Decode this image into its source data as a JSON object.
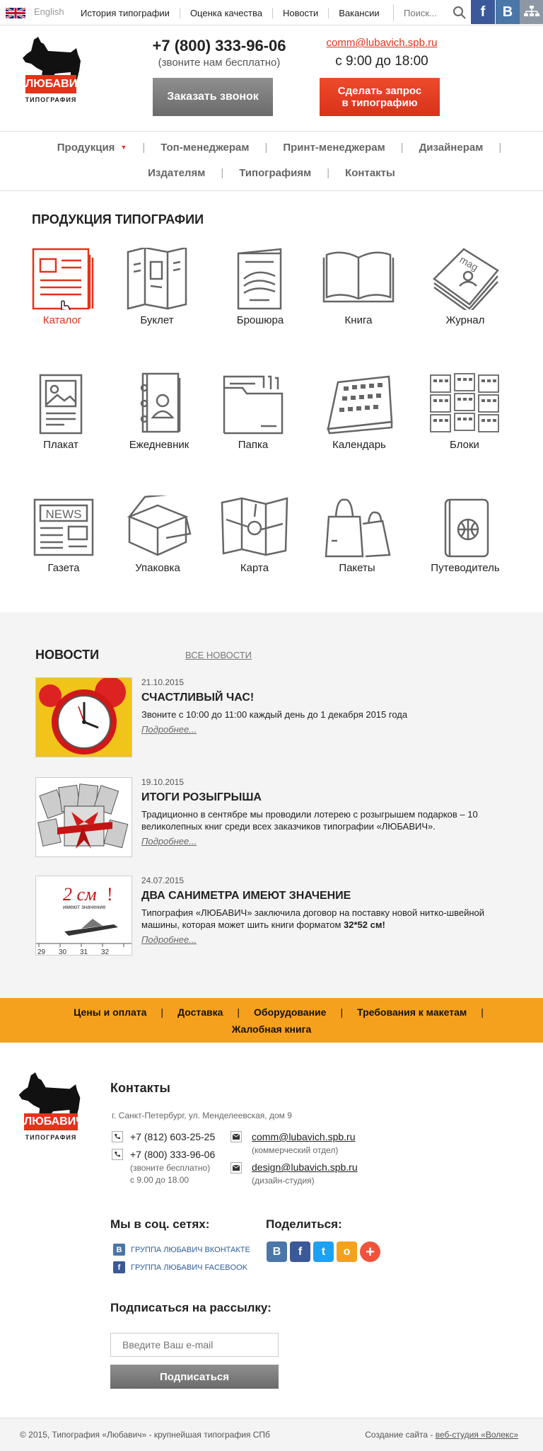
{
  "topbar": {
    "lang": "English",
    "nav": [
      "История типографии",
      "Оценка качества",
      "Новости",
      "Вакансии"
    ],
    "search_placeholder": "Поиск...",
    "social": [
      "f",
      "В"
    ]
  },
  "header": {
    "logo_label": "ЛЮБАВИЧ",
    "logo_sub": "ТИПОГРАФИЯ",
    "phone": "+7 (800) 333-96-06",
    "phone_note": "(звоните нам бесплатно)",
    "call_button": "Заказать звонок",
    "email": "comm@lubavich.spb.ru",
    "hours": "с 9:00 до 18:00",
    "request_button_line1": "Сделать запрос",
    "request_button_line2": "в типографию"
  },
  "nav": {
    "row1": [
      "Продукция",
      "Топ-менеджерам",
      "Принт-менеджерам",
      "Дизайнерам"
    ],
    "row2": [
      "Издателям",
      "Типографиям",
      "Контакты"
    ]
  },
  "products": {
    "title": "ПРОДУКЦИЯ ТИПОГРАФИИ",
    "items": [
      "Каталог",
      "Буклет",
      "Брошюра",
      "Книга",
      "Журнал",
      "Плакат",
      "Ежедневник",
      "Папка",
      "Календарь",
      "Блоки",
      "Газета",
      "Упаковка",
      "Карта",
      "Пакеты",
      "Путеводитель"
    ],
    "icon_text": {
      "news": "NEWS",
      "mag": "mag"
    },
    "accent_color": "#e4321b"
  },
  "news": {
    "title": "НОВОСТИ",
    "all_link": "ВСЕ НОВОСТИ",
    "more": "Подробнее...",
    "items": [
      {
        "date": "21.10.2015",
        "title": "СЧАСТЛИВЫЙ ЧАС!",
        "text": "Звоните с 10:00 до 11:00 каждый день до 1 декабря 2015 года"
      },
      {
        "date": "19.10.2015",
        "title": "ИТОГИ РОЗЫГРЫША",
        "text": "Традиционно в сентябре мы проводили лотерею с розыгрышем подарков – 10 великолепных книг среди всех заказчиков типографии «ЛЮБАВИЧ»."
      },
      {
        "date": "24.07.2015",
        "title": "ДВА САНИМЕТРА ИМЕЮТ ЗНАЧЕНИЕ",
        "text_plain": "Типография «ЛЮБАВИЧ» заключила договор на поставку новой нитко-швейной машины, которая может шить книги форматом ",
        "text_bold": "32*52 см!"
      }
    ],
    "image3_text": {
      "big": "2 см",
      "exclaim": "!",
      "small": "имеют значение",
      "ruler": [
        "29",
        "30",
        "31",
        "32"
      ]
    }
  },
  "orange_bar": {
    "row1": [
      "Цены и оплата",
      "Доставка",
      "Оборудование",
      "Требования к макетам"
    ],
    "row2": [
      "Жалобная книга"
    ]
  },
  "footer": {
    "contacts_title": "Контакты",
    "address": "г. Санкт-Петербург, ул. Менделеевская, дом 9",
    "phone1": "+7 (812) 603-25-25",
    "phone2": "+7 (800) 333-96-06",
    "phone2_note": "(звоните бесплатно)",
    "hours": "с 9.00 до 18.00",
    "email1": "comm@lubavich.spb.ru",
    "email1_note": "(коммерческий отдел)",
    "email2": "design@lubavich.spb.ru",
    "email2_note": "(дизайн-студия)",
    "social_title": "Мы в соц. сетях:",
    "social_vk": "ГРУППА ЛЮБАВИЧ ВКОНТАКТЕ",
    "social_fb": "ГРУППА ЛЮБАВИЧ FACEBOOK",
    "share_title": "Поделиться:",
    "share_glyphs": [
      "В",
      "f",
      "t",
      "о",
      "+"
    ],
    "subscribe_title": "Подписаться на рассылку:",
    "subscribe_placeholder": "Введите Ваш e-mail",
    "subscribe_button": "Подписаться",
    "copyright": "© 2015, Типография «Любавич» - крупнейшая типография СПб",
    "dev_prefix": "Создание сайта - ",
    "dev_link": "веб-студия «Волекс»"
  }
}
